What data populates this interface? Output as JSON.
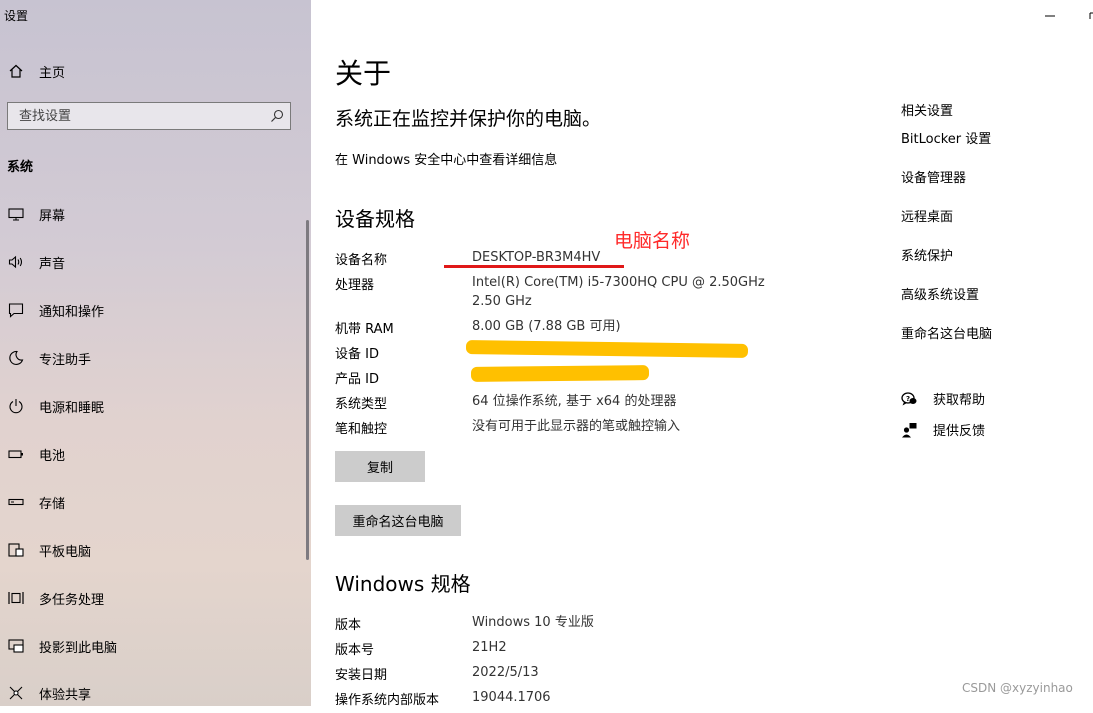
{
  "window": {
    "title": "设置"
  },
  "sidebar": {
    "home_label": "主页",
    "search_placeholder": "查找设置",
    "section_label": "系统",
    "items": [
      {
        "label": "屏幕",
        "icon": "monitor-icon"
      },
      {
        "label": "声音",
        "icon": "speaker-icon"
      },
      {
        "label": "通知和操作",
        "icon": "notification-icon"
      },
      {
        "label": "专注助手",
        "icon": "moon-icon"
      },
      {
        "label": "电源和睡眠",
        "icon": "power-icon"
      },
      {
        "label": "电池",
        "icon": "battery-icon"
      },
      {
        "label": "存储",
        "icon": "storage-icon"
      },
      {
        "label": "平板电脑",
        "icon": "tablet-icon"
      },
      {
        "label": "多任务处理",
        "icon": "multitask-icon"
      },
      {
        "label": "投影到此电脑",
        "icon": "project-icon"
      },
      {
        "label": "体验共享",
        "icon": "share-icon"
      }
    ]
  },
  "main": {
    "title": "关于",
    "protect_text": "系统正在监控并保护你的电脑。",
    "security_link": "在 Windows 安全中心中查看详细信息",
    "device_specs": {
      "heading": "设备规格",
      "rows": [
        {
          "key": "设备名称",
          "value": "DESKTOP-BR3M4HV"
        },
        {
          "key": "处理器",
          "value": "Intel(R) Core(TM) i5-7300HQ CPU @ 2.50GHz",
          "value2": "2.50 GHz"
        },
        {
          "key": "机带 RAM",
          "value": "8.00 GB (7.88 GB 可用)"
        },
        {
          "key": "设备 ID",
          "value": ""
        },
        {
          "key": "产品 ID",
          "value": ""
        },
        {
          "key": "系统类型",
          "value": "64 位操作系统, 基于 x64 的处理器"
        },
        {
          "key": "笔和触控",
          "value": "没有可用于此显示器的笔或触控输入"
        }
      ],
      "copy_button": "复制",
      "rename_button": "重命名这台电脑"
    },
    "annotation": {
      "label": "电脑名称",
      "color": "#ff2a2a",
      "redaction_color": "#ffc000"
    },
    "windows_specs": {
      "heading": "Windows 规格",
      "rows": [
        {
          "key": "版本",
          "value": "Windows 10 专业版"
        },
        {
          "key": "版本号",
          "value": "21H2"
        },
        {
          "key": "安装日期",
          "value": "2022/5/13"
        },
        {
          "key": "操作系统内部版本",
          "value": "19044.1706"
        }
      ]
    }
  },
  "related": {
    "title": "相关设置",
    "links": [
      "BitLocker 设置",
      "设备管理器",
      "远程桌面",
      "系统保护",
      "高级系统设置",
      "重命名这台电脑"
    ],
    "help": [
      {
        "label": "获取帮助",
        "icon": "help-chat-icon"
      },
      {
        "label": "提供反馈",
        "icon": "feedback-icon"
      }
    ]
  },
  "watermark": "CSDN @xyzyinhao"
}
